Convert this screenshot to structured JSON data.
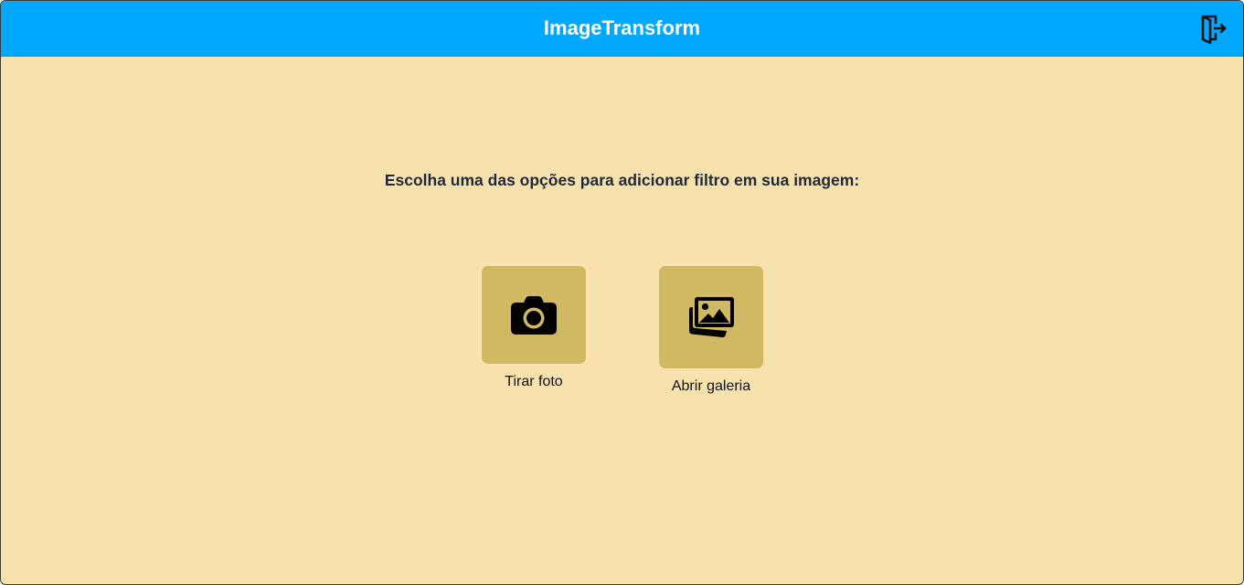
{
  "header": {
    "title": "ImageTransform",
    "background_color": "#00a8ff",
    "logout_icon": "logout-door-icon"
  },
  "main": {
    "background_color": "#f7e2ad",
    "prompt": "Escolha uma das opções para adicionar filtro em sua imagem:",
    "options": [
      {
        "label": "Tirar foto",
        "icon": "camera-icon",
        "tile_color": "#d1b964"
      },
      {
        "label": "Abrir galeria",
        "icon": "gallery-icon",
        "tile_color": "#d1b964"
      }
    ]
  }
}
